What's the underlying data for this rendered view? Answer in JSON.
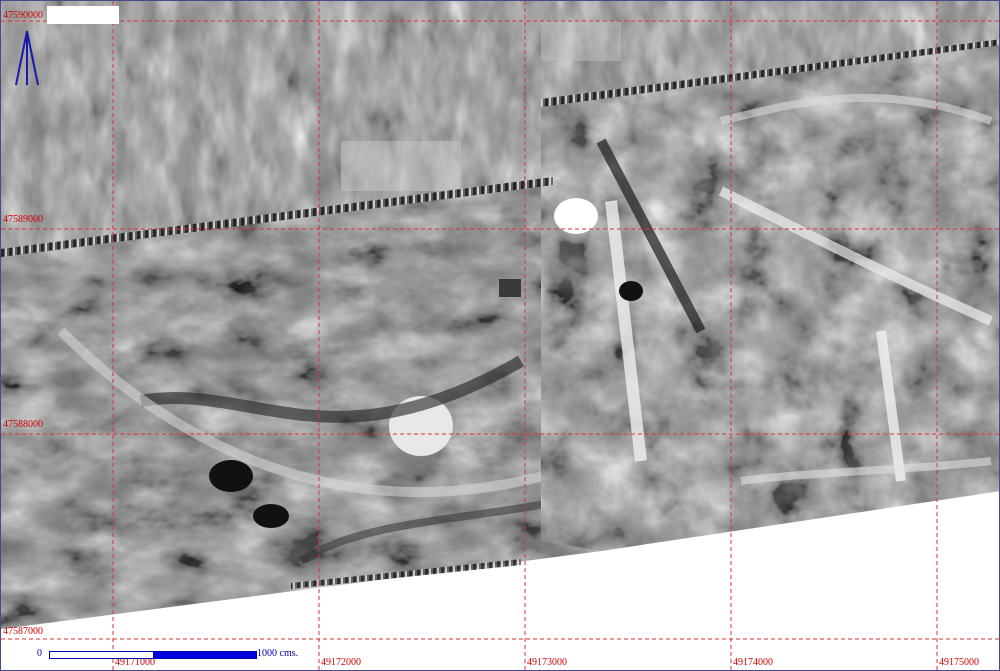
{
  "map": {
    "grid_labels": {
      "y": [
        "47590000",
        "47589000",
        "47588000",
        "47587000"
      ],
      "x": [
        "49171000",
        "49172000",
        "49173000",
        "49174000",
        "49175000"
      ]
    },
    "scale": {
      "start": "0",
      "end": "1000 cms."
    },
    "colors": {
      "grid": "#dd3333",
      "label": "#cc0000",
      "scale": "#0000dd",
      "north_arrow": "#1a1aaa"
    },
    "icons": {
      "north": "north-arrow-icon"
    }
  }
}
